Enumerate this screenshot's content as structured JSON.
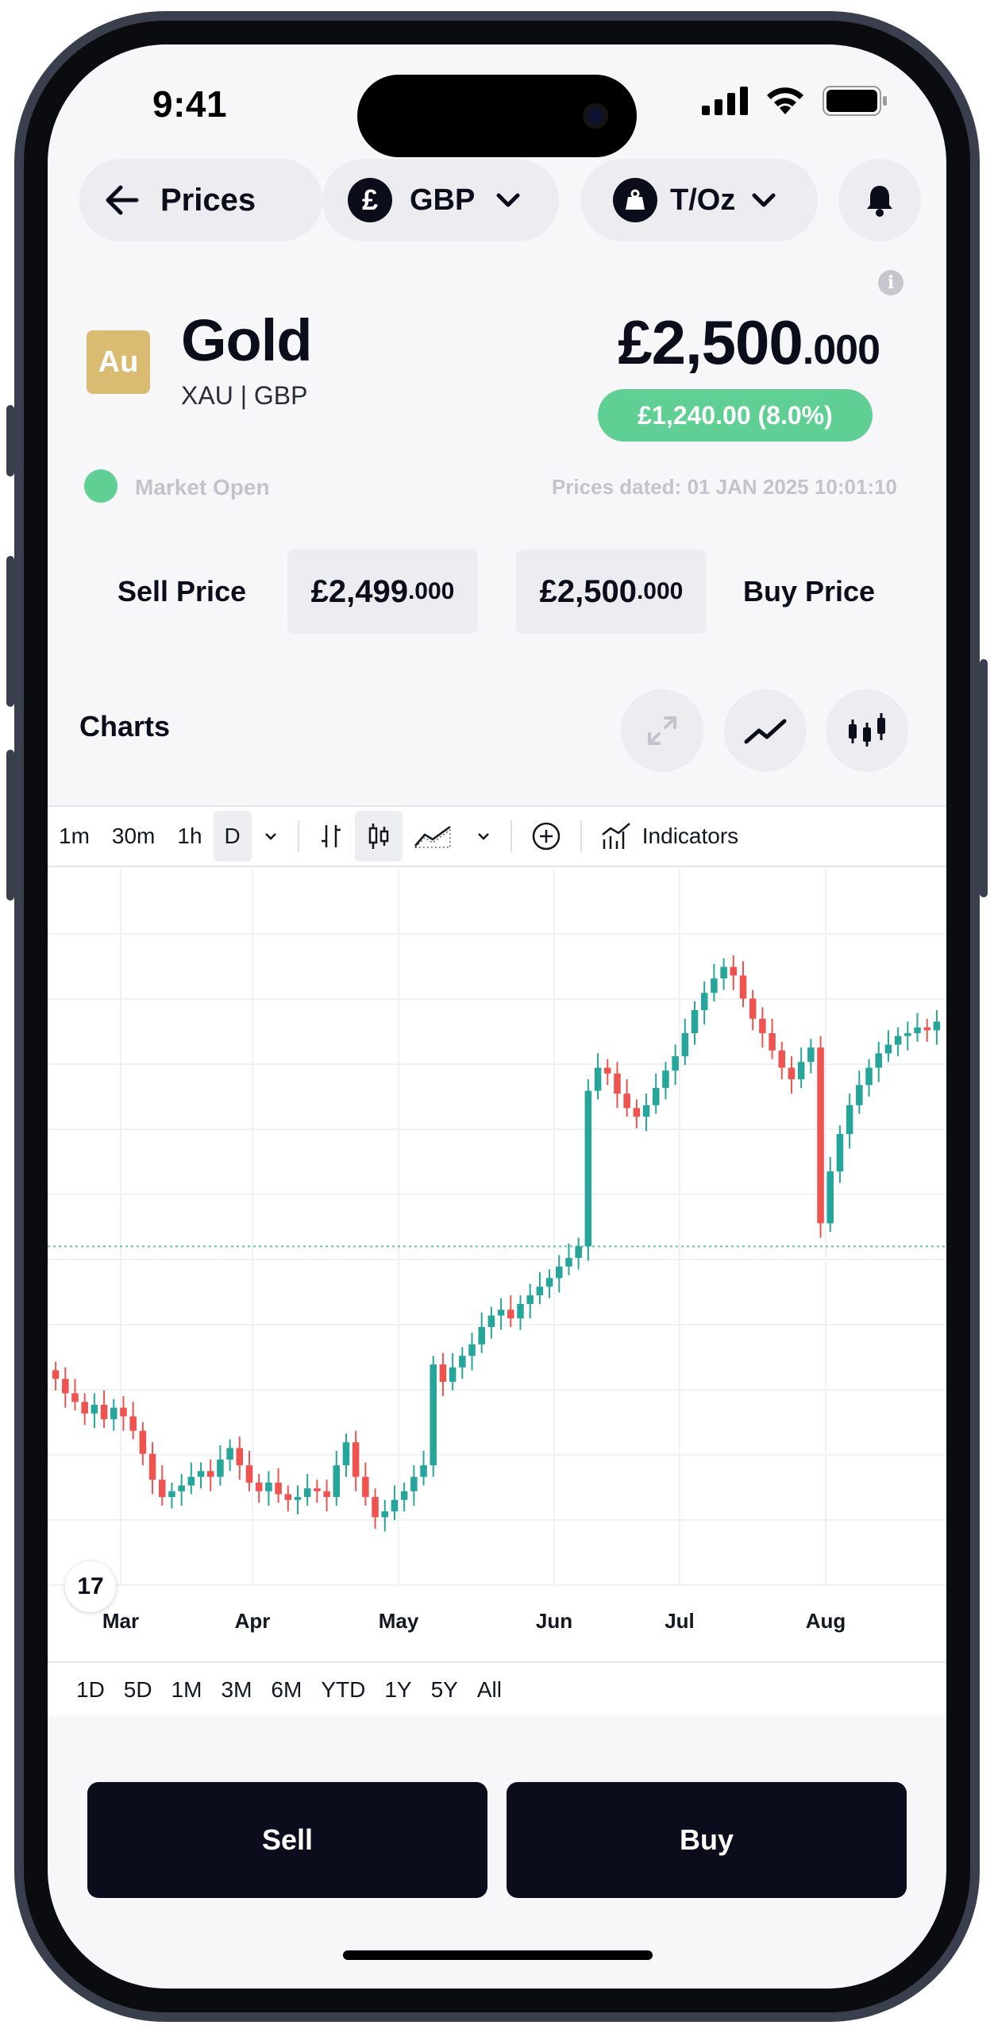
{
  "status_bar": {
    "time": "9:41"
  },
  "nav": {
    "back_label": "Prices",
    "currency_symbol": "£",
    "currency": "GBP",
    "unit": "T/Oz"
  },
  "asset": {
    "badge": "Au",
    "name": "Gold",
    "pair": "XAU | GBP",
    "price_main": "£2,500",
    "price_decimals": ".000",
    "change": "£1,240.00 (8.0%)",
    "change_color": "#5fcf93",
    "badge_color": "#d9bc72"
  },
  "market": {
    "status": "Market Open",
    "prices_dated": "Prices dated: 01 JAN 2025 10:01:10"
  },
  "quotes": {
    "sell_label": "Sell Price",
    "sell_main": "£2,499",
    "sell_decimals": ".000",
    "buy_main": "£2,500",
    "buy_decimals": ".000",
    "buy_label": "Buy Price"
  },
  "charts": {
    "title": "Charts",
    "buttons": [
      "expand-icon",
      "line-chart-icon",
      "candlestick-icon"
    ],
    "toolbar": {
      "intervals": [
        "1m",
        "30m",
        "1h",
        "D"
      ],
      "active_interval": "D",
      "indicators_label": "Indicators"
    },
    "ranges": [
      "1D",
      "5D",
      "1M",
      "3M",
      "6M",
      "YTD",
      "1Y",
      "5Y",
      "All"
    ],
    "logo_text": "17"
  },
  "chart_data": {
    "type": "candlestick",
    "x_tick_labels": [
      "Mar",
      "Apr",
      "May",
      "Jun",
      "Jul",
      "Aug"
    ],
    "up_color": "#26a69a",
    "down_color": "#ef5350",
    "grid": true,
    "last_price_line": true,
    "closes": [
      2040,
      2035,
      2032,
      2028,
      2031,
      2026,
      2030,
      2027,
      2022,
      2014,
      2005,
      1999,
      2001,
      2003,
      2006,
      2008,
      2006,
      2012,
      2016,
      2010,
      2004,
      2001,
      2004,
      2000,
      1998,
      1999,
      2002,
      2001,
      1999,
      2010,
      2018,
      2006,
      1999,
      1992,
      1994,
      1998,
      2001,
      2006,
      2010,
      2045,
      2039,
      2044,
      2048,
      2052,
      2058,
      2062,
      2064,
      2061,
      2066,
      2069,
      2072,
      2075,
      2079,
      2082,
      2086,
      2140,
      2148,
      2146,
      2139,
      2134,
      2131,
      2135,
      2141,
      2147,
      2152,
      2160,
      2168,
      2174,
      2179,
      2183,
      2180,
      2172,
      2165,
      2160,
      2154,
      2148,
      2144,
      2150,
      2155,
      2094,
      2112,
      2125,
      2135,
      2142,
      2148,
      2153,
      2156,
      2159,
      2160,
      2162,
      2161,
      2164
    ]
  },
  "actions": {
    "sell": "Sell",
    "buy": "Buy"
  }
}
